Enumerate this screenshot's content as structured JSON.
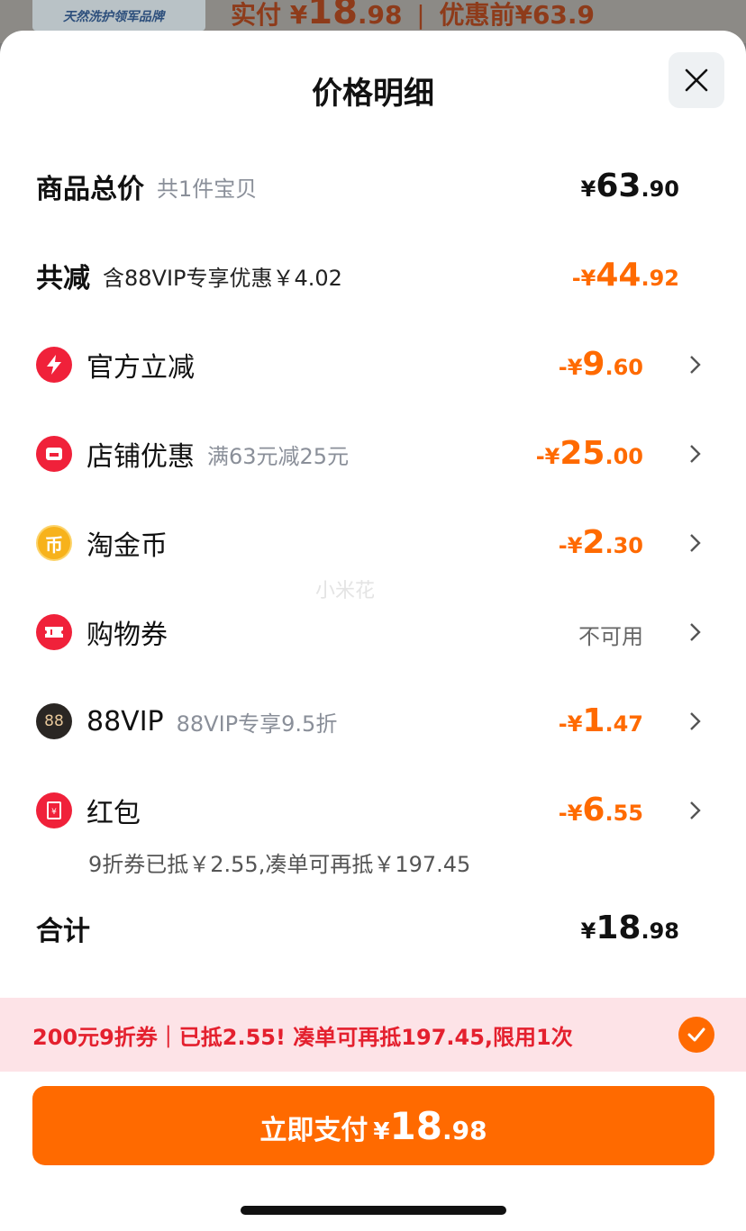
{
  "background": {
    "thumb_text": "天然洗护领军品牌",
    "paid_label": "实付",
    "paid_currency": "¥",
    "paid_int": "18",
    "paid_dec": ".98",
    "separator": "|",
    "before_discount": "优惠前¥63.9"
  },
  "header": {
    "title": "价格明细",
    "close_icon": "close-icon"
  },
  "rows": {
    "total": {
      "label": "商品总价",
      "sub": "共1件宝贝",
      "cur": "¥",
      "int": "63",
      "dec": ".90"
    },
    "reduce": {
      "label": "共减",
      "sub": "含88VIP专享优惠￥4.02",
      "cur": "-¥",
      "int": "44",
      "dec": ".92"
    },
    "official": {
      "label": "官方立减",
      "cur": "-¥",
      "int": "9",
      "dec": ".60",
      "icon": "lightning-icon"
    },
    "shop": {
      "label": "店铺优惠",
      "sub": "满63元减25元",
      "cur": "-¥",
      "int": "25",
      "dec": ".00",
      "icon": "shop-icon"
    },
    "coin": {
      "label": "淘金币",
      "cur": "-¥",
      "int": "2",
      "dec": ".30",
      "icon": "coin-icon",
      "icon_text": "币"
    },
    "voucher": {
      "label": "购物券",
      "status": "不可用",
      "icon": "ticket-icon"
    },
    "vip": {
      "label": "88VIP",
      "sub": "88VIP专享9.5折",
      "cur": "-¥",
      "int": "1",
      "dec": ".47",
      "icon": "vip88-icon",
      "icon_text": "88"
    },
    "redpacket": {
      "label": "红包",
      "cur": "-¥",
      "int": "6",
      "dec": ".55",
      "icon": "red-packet-icon",
      "note": "9折券已抵￥2.55,凑单可再抵￥197.45"
    },
    "sum": {
      "label": "合计",
      "cur": "¥",
      "int": "18",
      "dec": ".98"
    }
  },
  "watermark": "小米花",
  "coupon": {
    "text": "200元9折券｜已抵2.55! 凑单可再抵197.45,限用1次",
    "icon": "check-circle-icon"
  },
  "pay_button": {
    "label": "立即支付",
    "cur": "¥",
    "int": "18",
    "dec": ".98"
  },
  "colors": {
    "accent": "#ff6a00",
    "coupon_bg": "#fde3e7",
    "coupon_text": "#e4202e",
    "red_icon": "#f0213a"
  }
}
